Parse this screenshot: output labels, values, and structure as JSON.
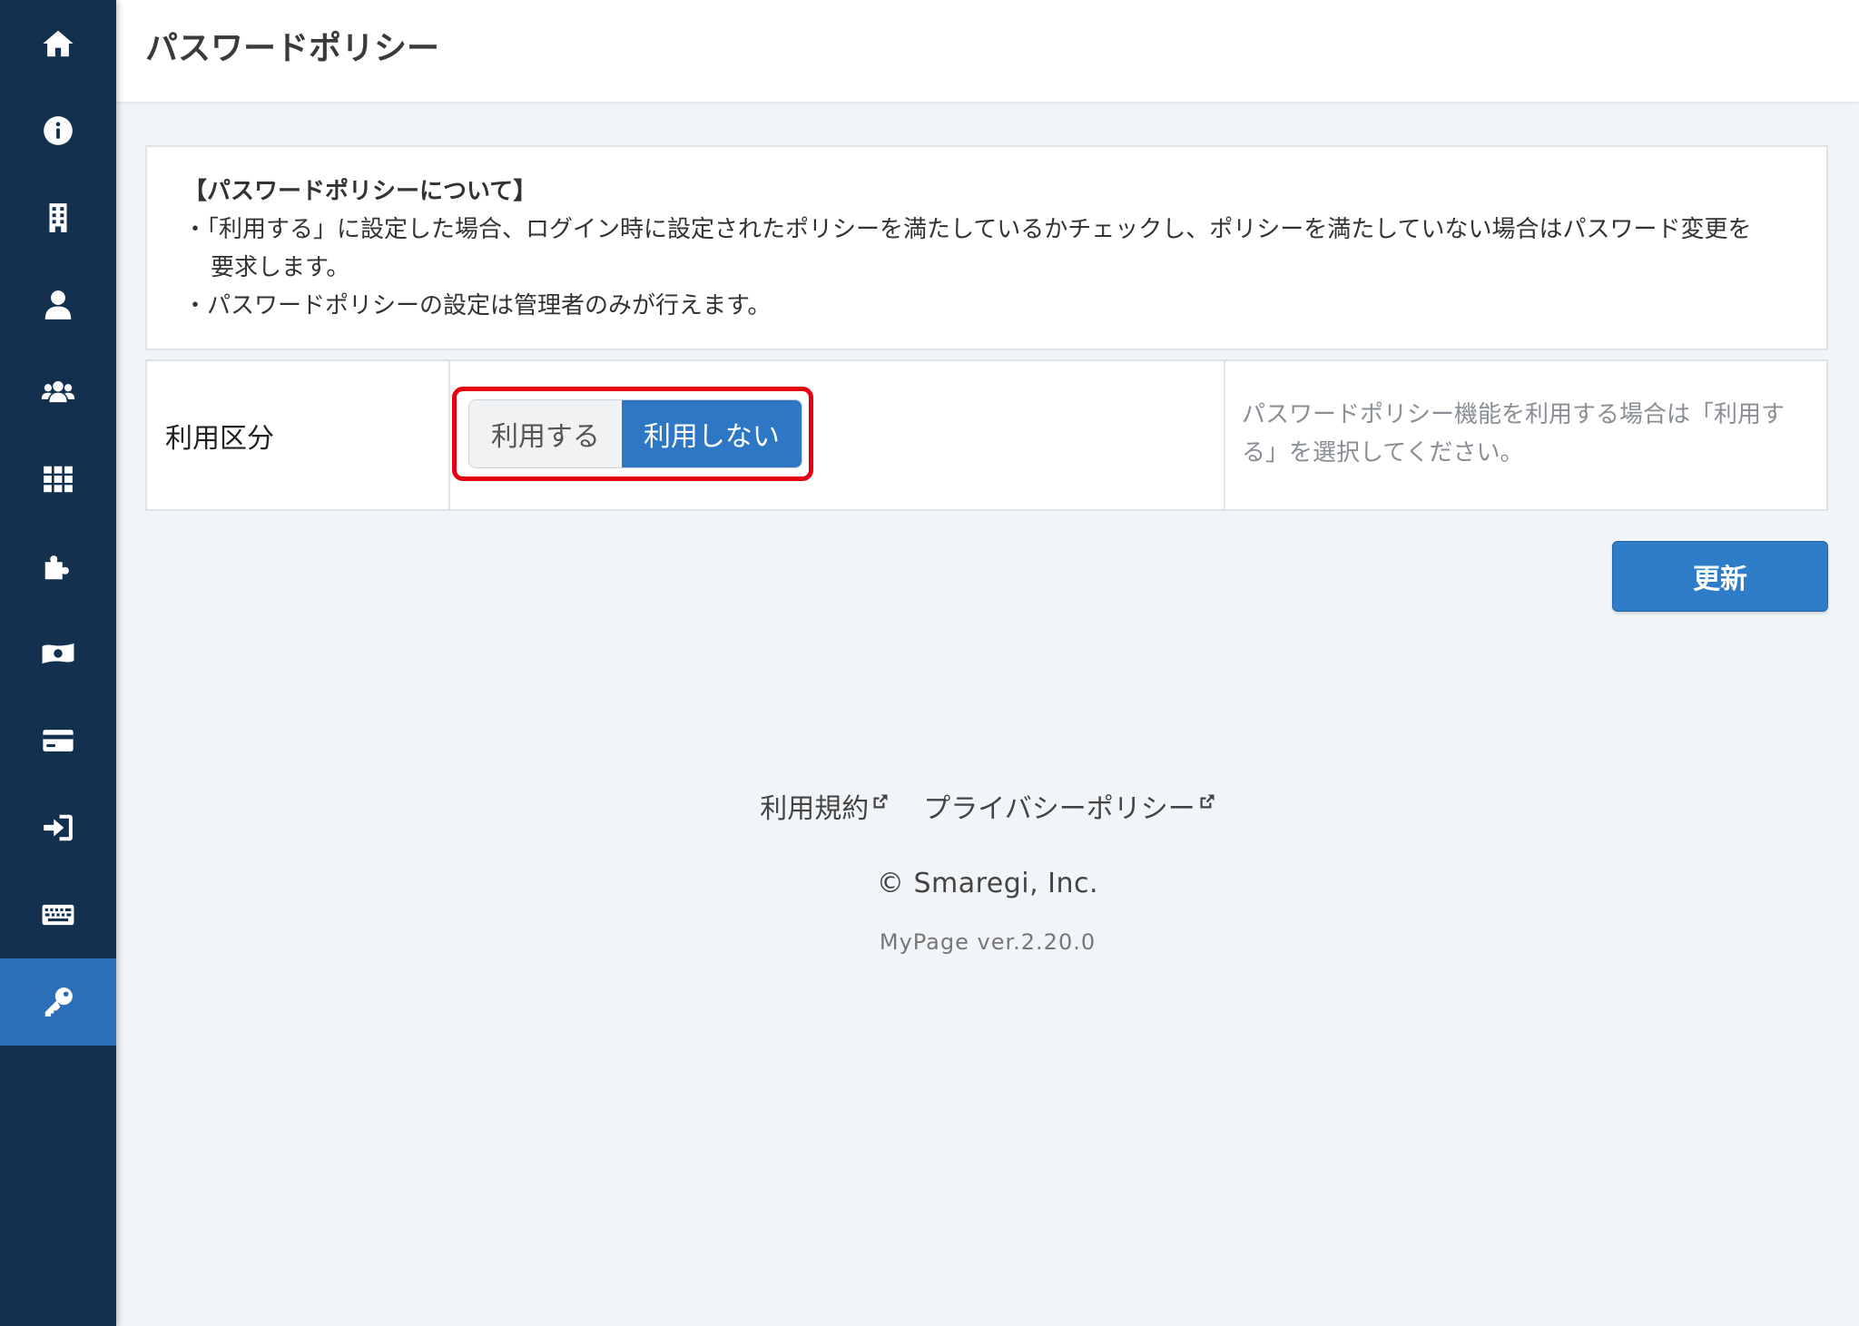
{
  "sidebar": {
    "items": [
      {
        "icon": "home-icon",
        "name": "nav-home",
        "active": false
      },
      {
        "icon": "info-icon",
        "name": "nav-info",
        "active": false
      },
      {
        "icon": "building-icon",
        "name": "nav-company",
        "active": false
      },
      {
        "icon": "user-icon",
        "name": "nav-user",
        "active": false
      },
      {
        "icon": "users-icon",
        "name": "nav-users",
        "active": false
      },
      {
        "icon": "grid-icon",
        "name": "nav-apps",
        "active": false
      },
      {
        "icon": "puzzle-icon",
        "name": "nav-addons",
        "active": false
      },
      {
        "icon": "money-icon",
        "name": "nav-billing",
        "active": false
      },
      {
        "icon": "credit-card-icon",
        "name": "nav-payment",
        "active": false
      },
      {
        "icon": "sign-in-icon",
        "name": "nav-login",
        "active": false
      },
      {
        "icon": "keyboard-icon",
        "name": "nav-keyboard",
        "active": false
      },
      {
        "icon": "key-icon",
        "name": "nav-password-policy",
        "active": true
      }
    ],
    "colors": {
      "background": "#14304f",
      "active": "#2a6fb8"
    }
  },
  "header": {
    "title": "パスワードポリシー"
  },
  "info": {
    "title": "【パスワードポリシーについて】",
    "line1": "・「利用する」に設定した場合、ログイン時に設定されたポリシーを満たしているかチェックし、ポリシーを満たしていない場合はパスワード変更を",
    "line1_cont": "要求します。",
    "line2": "・パスワードポリシーの設定は管理者のみが行えます。"
  },
  "setting": {
    "label": "利用区分",
    "options": [
      "利用する",
      "利用しない"
    ],
    "selected": "利用しない",
    "help": "パスワードポリシー機能を利用する場合は「利用する」を選択してください。"
  },
  "actions": {
    "update_label": "更新"
  },
  "footer": {
    "terms": "利用規約",
    "privacy": "プライバシーポリシー",
    "copyright": "© Smaregi, Inc.",
    "version": "MyPage ver.2.20.0"
  },
  "colors": {
    "accent": "#2d77c5",
    "highlight": "#e60012",
    "page_bg": "#f2f5f8"
  }
}
